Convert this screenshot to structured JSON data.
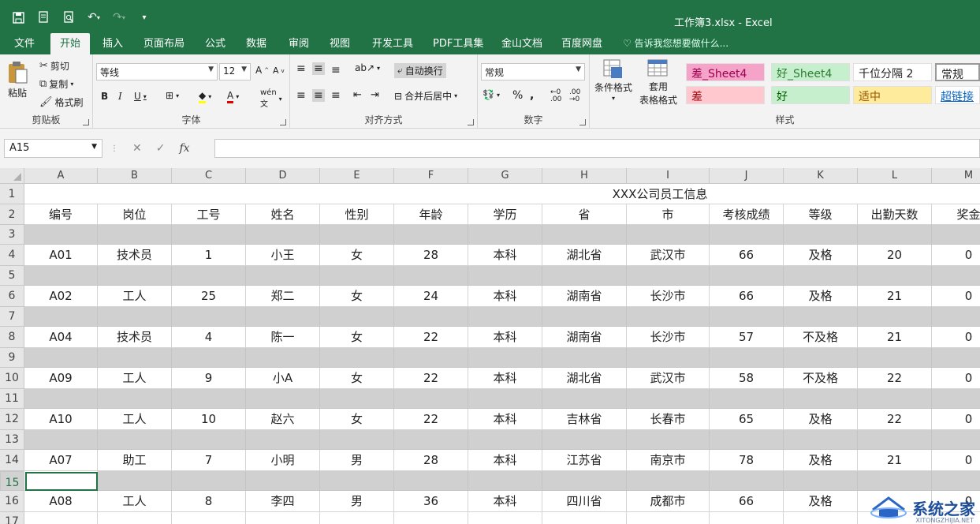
{
  "window": {
    "title": "工作簿3.xlsx - Excel"
  },
  "tabs": [
    {
      "label": "文件",
      "active": false
    },
    {
      "label": "开始",
      "active": true
    },
    {
      "label": "插入",
      "active": false
    },
    {
      "label": "页面布局",
      "active": false
    },
    {
      "label": "公式",
      "active": false
    },
    {
      "label": "数据",
      "active": false
    },
    {
      "label": "审阅",
      "active": false
    },
    {
      "label": "视图",
      "active": false
    },
    {
      "label": "开发工具",
      "active": false
    },
    {
      "label": "PDF工具集",
      "active": false
    },
    {
      "label": "金山文档",
      "active": false
    },
    {
      "label": "百度网盘",
      "active": false
    }
  ],
  "tell_me": "告诉我您想要做什么...",
  "ribbon": {
    "clipboard": {
      "label": "剪贴板",
      "paste": "粘贴",
      "cut": "剪切",
      "copy": "复制",
      "format_painter": "格式刷"
    },
    "font": {
      "label": "字体",
      "font_name": "等线",
      "font_size": "12"
    },
    "alignment": {
      "label": "对齐方式",
      "wrap_text": "自动换行",
      "merge_center": "合并后居中"
    },
    "number": {
      "label": "数字",
      "format": "常规"
    },
    "styles": {
      "label": "样式",
      "conditional_format": "条件格式",
      "format_table_1": "套用",
      "format_table_2": "表格格式",
      "cell_styles": [
        {
          "text": "差_Sheet4",
          "bg": "#f6a3c9",
          "color": "#9c0050"
        },
        {
          "text": "好_Sheet4",
          "bg": "#c6efce",
          "color": "#2e7d32"
        },
        {
          "text": "千位分隔 2",
          "bg": "#ffffff",
          "color": "#222222"
        },
        {
          "text": "常规",
          "bg": "#ffffff",
          "color": "#222222"
        },
        {
          "text": "差",
          "bg": "#ffc7ce",
          "color": "#9c0006"
        },
        {
          "text": "好",
          "bg": "#c6efce",
          "color": "#006100"
        },
        {
          "text": "适中",
          "bg": "#ffeb9c",
          "color": "#9c5700"
        },
        {
          "text": "超链接",
          "bg": "#ffffff",
          "color": "#0563c1"
        }
      ]
    }
  },
  "formula_bar": {
    "name_box": "A15",
    "formula": ""
  },
  "sheet": {
    "columns": [
      "A",
      "B",
      "C",
      "D",
      "E",
      "F",
      "G",
      "H",
      "I",
      "J",
      "K",
      "L",
      "M"
    ],
    "title": "XXX公司员工信息",
    "headers": [
      "编号",
      "岗位",
      "工号",
      "姓名",
      "性别",
      "年龄",
      "学历",
      "省",
      "市",
      "考核成绩",
      "等级",
      "出勤天数",
      "奖金"
    ],
    "rows": [
      [
        "A01",
        "技术员",
        "1",
        "小王",
        "女",
        "28",
        "本科",
        "湖北省",
        "武汉市",
        "66",
        "及格",
        "20",
        "0"
      ],
      [
        "A02",
        "工人",
        "25",
        "郑二",
        "女",
        "24",
        "本科",
        "湖南省",
        "长沙市",
        "66",
        "及格",
        "21",
        "0"
      ],
      [
        "A04",
        "技术员",
        "4",
        "陈一",
        "女",
        "22",
        "本科",
        "湖南省",
        "长沙市",
        "57",
        "不及格",
        "21",
        "0"
      ],
      [
        "A09",
        "工人",
        "9",
        "小A",
        "女",
        "22",
        "本科",
        "湖北省",
        "武汉市",
        "58",
        "不及格",
        "22",
        "0"
      ],
      [
        "A10",
        "工人",
        "10",
        "赵六",
        "女",
        "22",
        "本科",
        "吉林省",
        "长春市",
        "65",
        "及格",
        "22",
        "0"
      ],
      [
        "A07",
        "助工",
        "7",
        "小明",
        "男",
        "28",
        "本科",
        "江苏省",
        "南京市",
        "78",
        "及格",
        "21",
        "0"
      ],
      [
        "A08",
        "工人",
        "8",
        "李四",
        "男",
        "36",
        "本科",
        "四川省",
        "成都市",
        "66",
        "及格",
        "",
        "0"
      ]
    ],
    "row_numbers": [
      "1",
      "2",
      "3",
      "4",
      "5",
      "6",
      "7",
      "8",
      "9",
      "10",
      "11",
      "12",
      "13",
      "14",
      "15",
      "16",
      "17"
    ],
    "active_cell": "A15"
  },
  "watermark": {
    "text": "系统之家",
    "sub": "XITONGZHIJIA.NET",
    "color": "#1e4f9a"
  }
}
